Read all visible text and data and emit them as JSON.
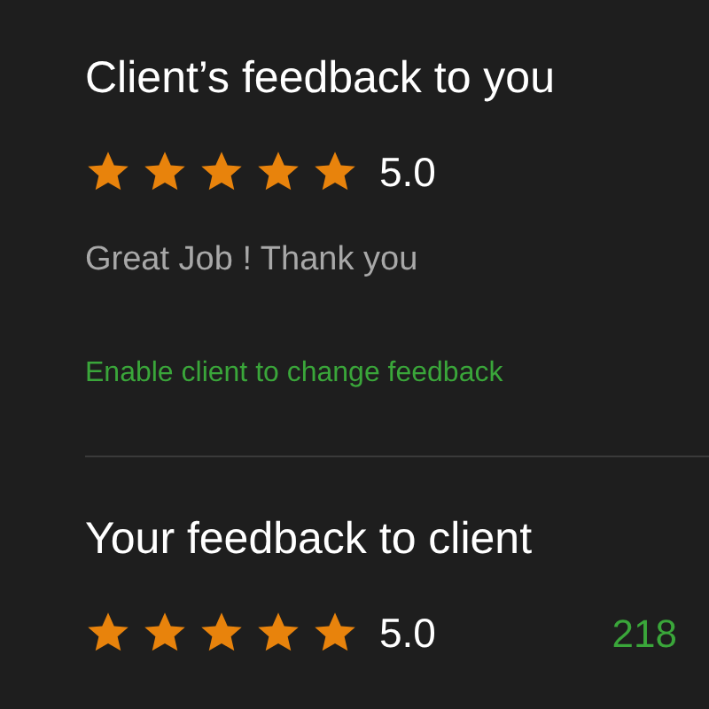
{
  "client_feedback": {
    "title": "Client’s feedback to you",
    "stars": 5,
    "rating": "5.0",
    "comment": "Great Job ! Thank you",
    "link": "Enable client to change feedback"
  },
  "your_feedback": {
    "title": "Your feedback to client",
    "stars": 5,
    "rating": "5.0",
    "count": "218"
  }
}
